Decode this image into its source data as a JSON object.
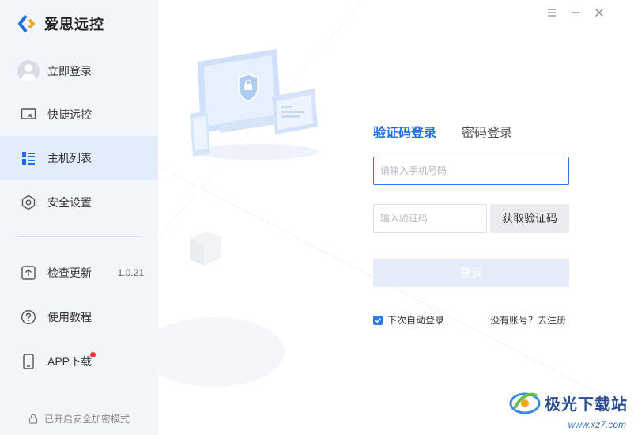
{
  "app": {
    "title": "爱思远控"
  },
  "sidebar": {
    "login": {
      "label": "立即登录"
    },
    "items": [
      {
        "label": "快捷远控",
        "icon": "monitor-icon"
      },
      {
        "label": "主机列表",
        "icon": "grid-list-icon"
      },
      {
        "label": "安全设置",
        "icon": "hexagon-shield-icon"
      }
    ],
    "bottom_items": [
      {
        "label": "检查更新",
        "icon": "upload-arrow-icon",
        "value": "1.0.21"
      },
      {
        "label": "使用教程",
        "icon": "help-circle-icon"
      },
      {
        "label": "APP下载",
        "icon": "phone-icon"
      }
    ],
    "footer": "已开启安全加密模式"
  },
  "login": {
    "tabs": [
      "验证码登录",
      "密码登录"
    ],
    "phone_placeholder": "请输入手机号码",
    "code_placeholder": "输入验证码",
    "get_code": "获取验证码",
    "submit": "登录",
    "auto_login": "下次自动登录",
    "register": "没有账号？去注册"
  },
  "watermark": {
    "title": "极光下载站",
    "url": "www.xz7.com"
  },
  "colors": {
    "accent": "#1d6ee6",
    "sidebar_bg": "#f2f5fa",
    "active_bg": "#e3ecfb"
  }
}
